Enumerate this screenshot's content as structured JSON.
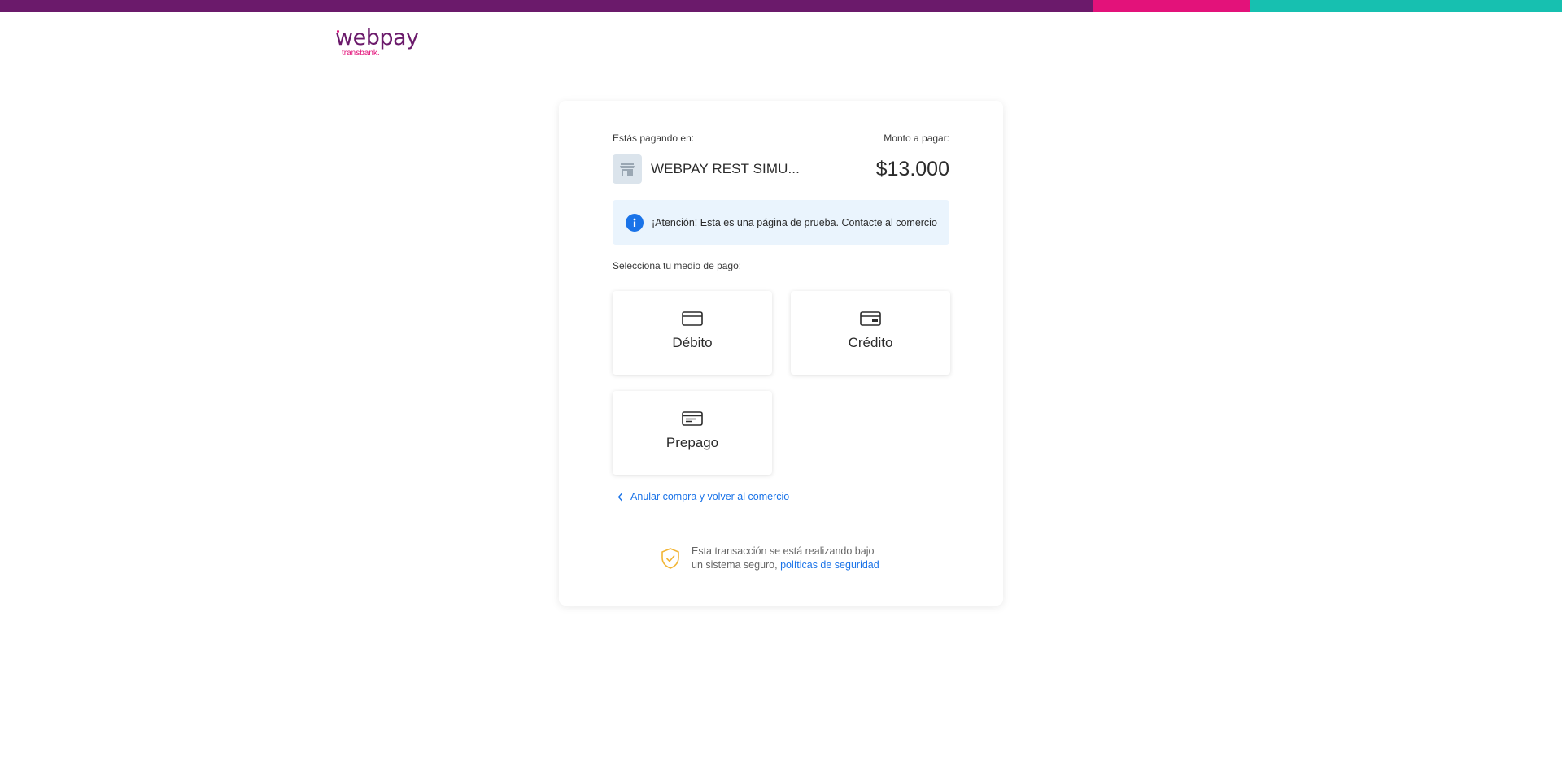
{
  "topbar": {
    "colors": {
      "purple": "#6b1a6b",
      "pink": "#e3127a",
      "teal": "#17c0b0"
    }
  },
  "logo": {
    "word": "webpay",
    "sub": "transbank."
  },
  "payment": {
    "paying_at_label": "Estás pagando en:",
    "amount_label": "Monto a pagar:",
    "merchant_name": "WEBPAY REST SIMU...",
    "merchant_icon": "store-icon",
    "amount": "$13.000"
  },
  "alert": {
    "icon": "info-icon",
    "text": "¡Atención! Esta es una página de prueba. Contacte al comercio"
  },
  "methods": {
    "label": "Selecciona tu medio de pago:",
    "items": [
      {
        "label": "Débito",
        "icon": "debit-card-icon"
      },
      {
        "label": "Crédito",
        "icon": "credit-card-icon"
      },
      {
        "label": "Prepago",
        "icon": "prepaid-card-icon"
      }
    ]
  },
  "cancel": {
    "label": "Anular compra y volver al comercio"
  },
  "security": {
    "icon": "shield-check-icon",
    "text": "Esta transacción se está realizando bajo un sistema seguro, ",
    "link": "políticas de seguridad"
  },
  "accent_colors": {
    "brand_purple": "#6b1a6b",
    "link_blue": "#1a73e8",
    "alert_bg": "#eaf4fd",
    "shield_yellow": "#f2b535"
  }
}
